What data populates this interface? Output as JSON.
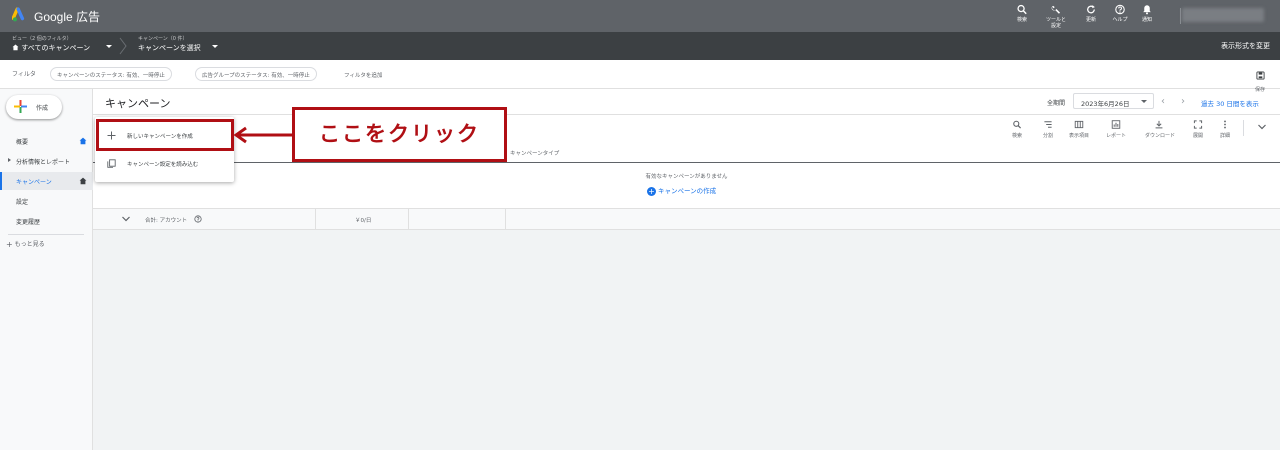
{
  "app": {
    "brand": "Google 広告",
    "brand_colors": {
      "blue": "#4285f4",
      "yellow": "#fbbc04",
      "green": "#34a853"
    }
  },
  "top_tools": [
    {
      "icon": "search-icon",
      "label": "検索"
    },
    {
      "icon": "wrench-icon",
      "label": "ツールと\n設定"
    },
    {
      "icon": "refresh-icon",
      "label": "更新"
    },
    {
      "icon": "help-icon",
      "label": "ヘルプ"
    },
    {
      "icon": "bell-icon",
      "label": "通知"
    }
  ],
  "breadcrumb": {
    "view_small": "ビュー（2 個のフィルタ）",
    "view_main": "すべてのキャンペーン",
    "campaign_small": "キャンペーン（0 件）",
    "campaign_main": "キャンペーンを選択",
    "view_change": "表示形式を変更"
  },
  "filters": {
    "label": "フィルタ",
    "chips": [
      "キャンペーンのステータス: 有効、一時停止",
      "広告グループのステータス: 有効、一時停止"
    ],
    "add_filter": "フィルタを追加",
    "save_label": "保存"
  },
  "sidebar": {
    "create_label": "作成",
    "items": [
      {
        "label": "概要",
        "home": true,
        "expandable": false,
        "active": false
      },
      {
        "label": "分析情報とレポート",
        "home": false,
        "expandable": true,
        "active": false
      },
      {
        "label": "キャンペーン",
        "home": true,
        "expandable": false,
        "active": true
      },
      {
        "label": "設定",
        "home": false,
        "expandable": false,
        "active": false
      },
      {
        "label": "変更履歴",
        "home": false,
        "expandable": false,
        "active": false
      }
    ],
    "more_label": "もっと見る"
  },
  "main": {
    "title": "キャンペーン",
    "period_label": "全期間",
    "date_value": "2023年6月26日",
    "last_30": "過去 30 日間を表示",
    "table_tools": [
      {
        "icon": "search-icon",
        "label": "検索"
      },
      {
        "icon": "segment-icon",
        "label": "分割"
      },
      {
        "icon": "columns-icon",
        "label": "表示項目"
      },
      {
        "icon": "report-icon",
        "label": "レポート"
      },
      {
        "icon": "download-icon",
        "label": "ダウンロード"
      },
      {
        "icon": "expand-icon",
        "label": "展開"
      },
      {
        "icon": "more-vert-icon",
        "label": "詳細"
      }
    ],
    "column_campaign_type": "キャンペーンタイプ",
    "empty_message": "有効なキャンペーンがありません",
    "create_campaign_link": "キャンペーンの作成",
    "total_label": "合計: アカウント",
    "total_budget": "￥0/日"
  },
  "menu": {
    "items": [
      {
        "icon": "plus-icon",
        "label": "新しいキャンペーンを作成"
      },
      {
        "icon": "copy-icon",
        "label": "キャンペーン設定を読み込む"
      }
    ]
  },
  "annotation": {
    "callout": "ここをクリック",
    "color": "#b00f14"
  },
  "colors": {
    "topbar": "#5f6368",
    "subbar": "#3c4043",
    "accent": "#1a73e8"
  }
}
